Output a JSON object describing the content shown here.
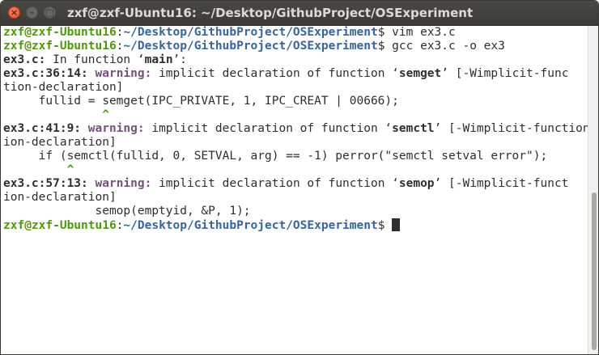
{
  "window": {
    "title": "zxf@zxf-Ubuntu16: ~/Desktop/GithubProject/OSExperiment",
    "close_glyph": "×",
    "minimize_glyph": "–",
    "maximize_glyph": "□"
  },
  "prompt": {
    "user": "zxf@zxf-Ubuntu16",
    "colon": ":",
    "path": "~/Desktop/GithubProject/OSExperiment",
    "dollar": "$"
  },
  "commands": [
    " vim ex3.c",
    " gcc ex3.c -o ex3"
  ],
  "output": {
    "in_function": {
      "pre": "ex3.c:",
      "text": " In function ",
      "q1": "‘",
      "name": "main",
      "q2": "’",
      "tail": ":"
    },
    "w1": {
      "loc": "ex3.c:36:14:",
      "label": "warning:",
      "msg": " implicit declaration of function ",
      "q1": "‘",
      "fn": "semget",
      "q2": "’",
      "flag_a": " [-Wimplicit-func",
      "flag_b": "tion-declaration]",
      "code": "     fullid = semget(IPC_PRIVATE, 1, IPC_CREAT | 00666);",
      "caret_pad": "              ",
      "caret": "^"
    },
    "w2": {
      "loc": "ex3.c:41:9:",
      "label": "warning:",
      "msg": " implicit declaration of function ",
      "q1": "‘",
      "fn": "semctl",
      "q2": "’",
      "flag_a": " [-Wimplicit-function",
      "flag_b": "ion-declaration]",
      "code": "     if (semctl(fullid, 0, SETVAL, arg) == -1) perror(\"semctl setval error\");",
      "caret_pad": "         ",
      "caret": "^"
    },
    "w3": {
      "loc": "ex3.c:57:13:",
      "label": "warning:",
      "msg": " implicit declaration of function ",
      "q1": "‘",
      "fn": "semop",
      "q2": "’",
      "flag_a": " [-Wimplicit-funct",
      "flag_b": "ion-declaration]",
      "code": "             semop(emptyid, &P, 1);",
      "caret_pad": "             ",
      "caret": "^"
    }
  },
  "colors": {
    "prompt_user": "#4e9a06",
    "prompt_path": "#3465a4",
    "warning": "#75507b",
    "caret": "#4e9a06",
    "text": "#2e2e2e",
    "titlebar": "#3c3b37",
    "close_button": "#e5531f"
  },
  "icons": [
    "close-icon",
    "minimize-icon",
    "maximize-icon"
  ]
}
